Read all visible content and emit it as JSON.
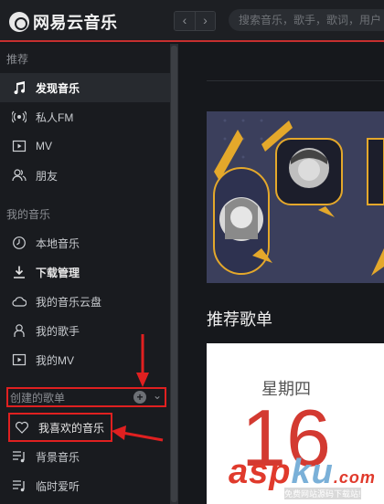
{
  "app": {
    "title": "网易云音乐"
  },
  "toolbar": {
    "back_glyph": "‹",
    "forward_glyph": "›"
  },
  "search": {
    "placeholder": "搜索音乐，歌手，歌词，用户"
  },
  "sidebar": {
    "recommend_label": "推荐",
    "recommend_items": [
      {
        "label": "发现音乐",
        "icon": "music-note-icon"
      },
      {
        "label": "私人FM",
        "icon": "radio-icon"
      },
      {
        "label": "MV",
        "icon": "video-icon"
      },
      {
        "label": "朋友",
        "icon": "friends-icon"
      }
    ],
    "my_music_label": "我的音乐",
    "my_music_items": [
      {
        "label": "本地音乐",
        "icon": "clock-icon"
      },
      {
        "label": "下载管理",
        "icon": "download-icon"
      },
      {
        "label": "我的音乐云盘",
        "icon": "cloud-icon"
      },
      {
        "label": "我的歌手",
        "icon": "singer-icon"
      },
      {
        "label": "我的MV",
        "icon": "video-icon"
      }
    ],
    "created_label": "创建的歌单",
    "created_items": [
      {
        "label": "我喜欢的音乐",
        "icon": "heart-icon"
      },
      {
        "label": "背景音乐",
        "icon": "playlist-icon"
      },
      {
        "label": "临时爱听",
        "icon": "playlist-icon"
      }
    ]
  },
  "main": {
    "section_title": "推荐歌单",
    "daily_card": {
      "weekday": "星期四",
      "day": "16"
    }
  },
  "watermark": {
    "brand_a": "asp",
    "brand_u": "k",
    "brand_b": "u",
    "brand_c": ".com",
    "sub": "免费网站源码下载站!"
  },
  "colors": {
    "accent": "#c62f2f",
    "annotation": "#e02020",
    "banner": "#3b3f5c"
  }
}
